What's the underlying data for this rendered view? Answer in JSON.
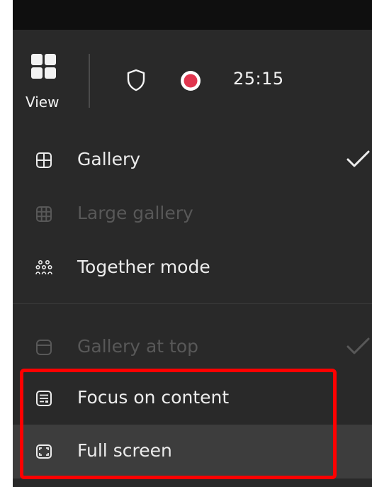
{
  "toolbar": {
    "view_label": "View",
    "timer": "25:15",
    "record_color": "#e0364f"
  },
  "menu": {
    "items": [
      {
        "label": "Gallery",
        "icon": "grid-icon",
        "enabled": true,
        "checked": true
      },
      {
        "label": "Large gallery",
        "icon": "large-grid-icon",
        "enabled": false,
        "checked": false
      },
      {
        "label": "Together mode",
        "icon": "people-group-icon",
        "enabled": true,
        "checked": false
      },
      {
        "label": "Gallery at top",
        "icon": "gallery-top-icon",
        "enabled": false,
        "checked": true
      },
      {
        "label": "Focus on content",
        "icon": "focus-content-icon",
        "enabled": true,
        "checked": false
      },
      {
        "label": "Full screen",
        "icon": "fullscreen-icon",
        "enabled": true,
        "checked": false,
        "hovered": true
      }
    ]
  },
  "colors": {
    "menu_background": "#292929",
    "hover_background": "#3d3d3d",
    "text": "#ececec",
    "disabled_text": "#585858",
    "annotation_outline": "#ff0000"
  }
}
